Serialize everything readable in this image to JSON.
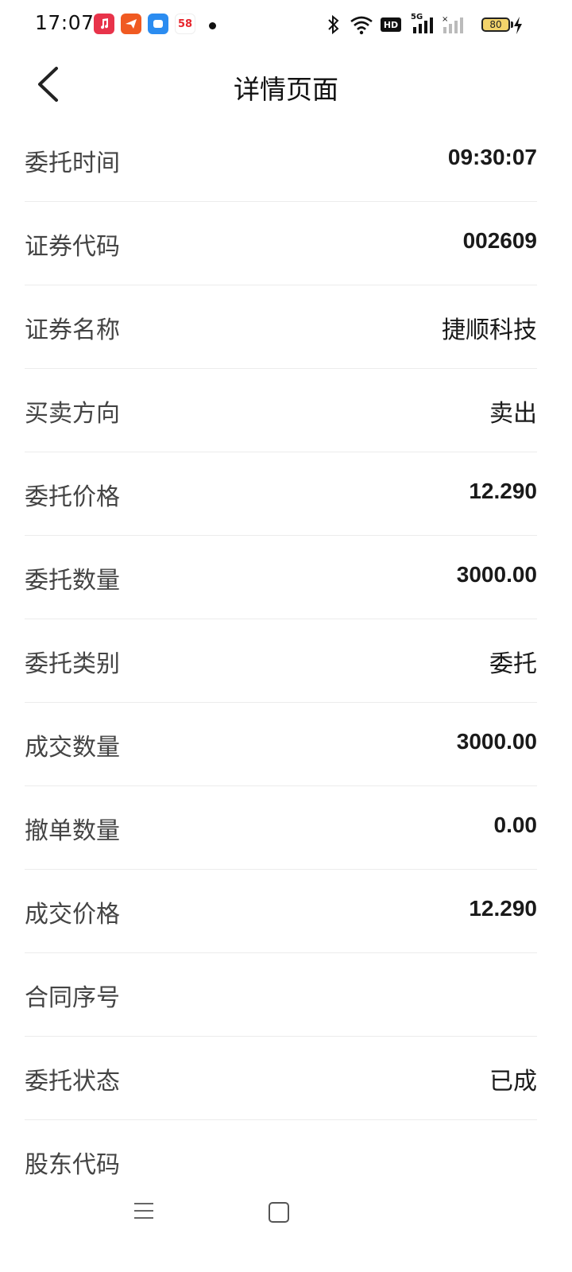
{
  "status_bar": {
    "time": "17:07",
    "app_icons": [
      "music-app-icon",
      "send-app-icon",
      "chat-app-icon",
      "58-app-icon"
    ],
    "app_58_label": "58",
    "network": "5G",
    "hd_label": "HD",
    "battery": "80"
  },
  "header": {
    "title": "详情页面"
  },
  "rows": [
    {
      "label": "委托时间",
      "value": "09:30:07"
    },
    {
      "label": "证券代码",
      "value": "002609"
    },
    {
      "label": "证券名称",
      "value": "捷顺科技"
    },
    {
      "label": "买卖方向",
      "value": "卖出"
    },
    {
      "label": "委托价格",
      "value": "12.290"
    },
    {
      "label": "委托数量",
      "value": "3000.00"
    },
    {
      "label": "委托类别",
      "value": "委托"
    },
    {
      "label": "成交数量",
      "value": "3000.00"
    },
    {
      "label": "撤单数量",
      "value": "0.00"
    },
    {
      "label": "成交价格",
      "value": "12.290"
    },
    {
      "label": "合同序号",
      "value": ""
    },
    {
      "label": "委托状态",
      "value": "已成"
    },
    {
      "label": "股东代码",
      "value": ""
    }
  ]
}
